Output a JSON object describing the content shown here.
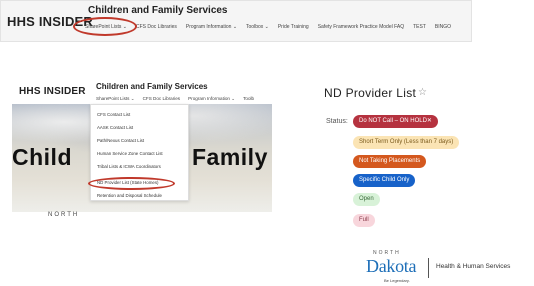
{
  "top": {
    "brand": "HHS INSIDER",
    "site": "Children and Family Services",
    "nav": [
      "SharePoint Lists ⌄",
      "CFS Doc Libraries",
      "Program Information ⌄",
      "Toolbox ⌄",
      "Pride Training",
      "Safety Framework Practice Model FAQ",
      "TEST",
      "BINGO"
    ]
  },
  "second": {
    "brand": "HHS INSIDER",
    "site": "Children and Family Services",
    "nav": [
      "SharePoint Lists ⌄",
      "CFS Doc Libraries",
      "Program Information ⌄",
      "Toolb"
    ],
    "hero_words": [
      "Child",
      "Family"
    ],
    "north": "NORTH"
  },
  "dropdown": {
    "items": [
      "CFS Contact List",
      "AASK Contact List",
      "Path/Nexus Contact List",
      "Human Service Zone Contact List",
      "Tribal Lists & ICWA Coordinators",
      "ND Provider List (State Homes)",
      "Retention and Disposal Schedule"
    ]
  },
  "panel": {
    "title": "ND Provider List",
    "star": "☆",
    "status_label": "Status:",
    "pills": [
      {
        "label": "Do NOT Call – ON HOLD✕",
        "bg": "#b5323f",
        "fg": "#ffffff"
      },
      {
        "label": "Short Term Only (Less than 7 days)",
        "bg": "#fbe4b4",
        "fg": "#7a5a1c"
      },
      {
        "label": "Not Taking Placements",
        "bg": "#d4581e",
        "fg": "#ffffff"
      },
      {
        "label": "Specific Child Only",
        "bg": "#1762c9",
        "fg": "#ffffff"
      },
      {
        "label": "Open",
        "bg": "#d8f2d8",
        "fg": "#3a6a3a"
      },
      {
        "label": "Full",
        "bg": "#f8d6dc",
        "fg": "#8a3a4a"
      }
    ]
  },
  "logo": {
    "north": "NORTH",
    "dakota": "Dakota",
    "hhs": "Health & Human Services",
    "tag": "Be Legendary."
  }
}
